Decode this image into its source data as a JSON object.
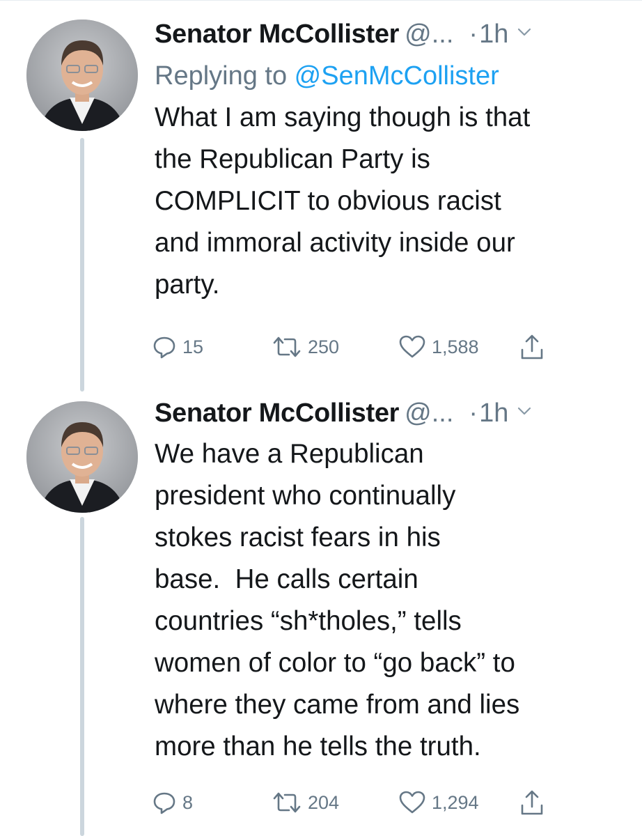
{
  "tweets": [
    {
      "author_name": "Senator McCollister",
      "handle": "@...",
      "separator": "·",
      "time": "1h",
      "replying_prefix": "Replying to ",
      "replying_handle": "@SenMcCollister",
      "text": "What I am saying though is that\nthe Republican Party is\nCOMPLICIT to obvious racist\nand immoral activity inside our\nparty.",
      "replies": "15",
      "retweets": "250",
      "likes": "1,588"
    },
    {
      "author_name": "Senator McCollister",
      "handle": "@...",
      "separator": "·",
      "time": "1h",
      "text": "We have a Republican\npresident who continually\nstokes racist fears in his\nbase.  He calls certain\ncountries “sh*tholes,” tells\nwomen of color to “go back” to\nwhere they came from and lies\nmore than he tells the truth.",
      "replies": "8",
      "retweets": "204",
      "likes": "1,294"
    }
  ],
  "icons": {
    "reply": "reply-icon",
    "retweet": "retweet-icon",
    "like": "heart-icon",
    "share": "share-icon",
    "caret": "chevron-down-icon"
  },
  "colors": {
    "link": "#1da1f2",
    "secondary": "#657786",
    "text": "#14171a",
    "thread_line": "#ccd6dd"
  }
}
